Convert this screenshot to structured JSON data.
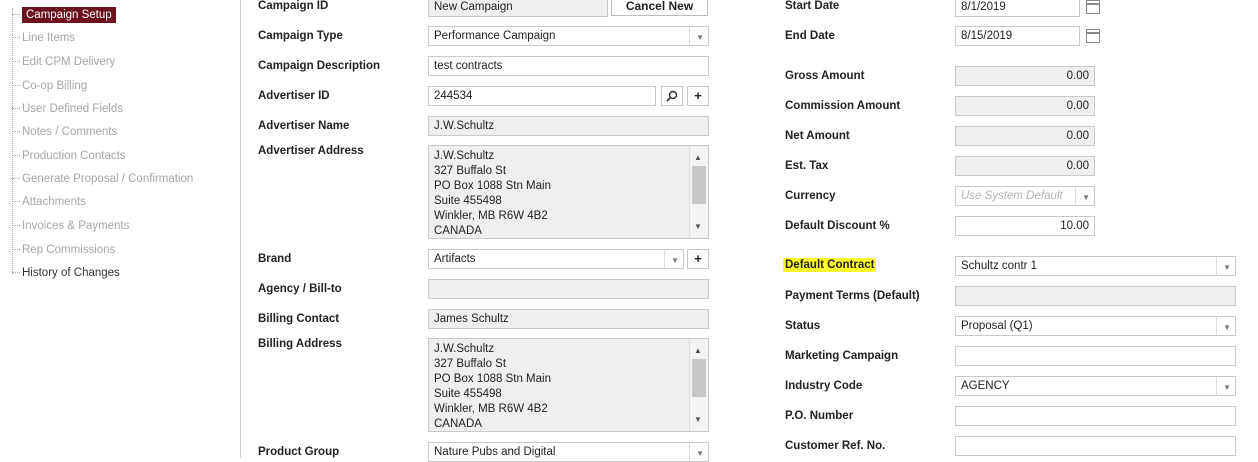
{
  "sidebar": {
    "items": [
      {
        "label": "Campaign Setup",
        "state": "active"
      },
      {
        "label": "Line Items",
        "state": "disabled"
      },
      {
        "label": "Edit CPM Delivery",
        "state": "disabled"
      },
      {
        "label": "Co-op Billing",
        "state": "disabled"
      },
      {
        "label": "User Defined Fields",
        "state": "disabled"
      },
      {
        "label": "Notes / Comments",
        "state": "disabled"
      },
      {
        "label": "Production Contacts",
        "state": "disabled"
      },
      {
        "label": "Generate Proposal / Confirmation",
        "state": "disabled"
      },
      {
        "label": "Attachments",
        "state": "disabled"
      },
      {
        "label": "Invoices & Payments",
        "state": "disabled"
      },
      {
        "label": "Rep Commissions",
        "state": "disabled"
      },
      {
        "label": "History of Changes",
        "state": "normal"
      }
    ]
  },
  "left": {
    "campaign_id": {
      "label": "Campaign ID",
      "value": "New Campaign"
    },
    "cancel_new": "Cancel New",
    "campaign_type": {
      "label": "Campaign Type",
      "value": "Performance Campaign"
    },
    "campaign_description": {
      "label": "Campaign Description",
      "value": "test contracts"
    },
    "advertiser_id": {
      "label": "Advertiser ID",
      "value": "244534"
    },
    "advertiser_name": {
      "label": "Advertiser Name",
      "value": "J.W.Schultz"
    },
    "advertiser_address": {
      "label": "Advertiser Address",
      "lines": [
        "J.W.Schultz",
        "327 Buffalo St",
        "PO Box 1088 Stn Main",
        "Suite 455498",
        "Winkler, MB R6W 4B2",
        "CANADA"
      ]
    },
    "brand": {
      "label": "Brand",
      "value": "Artifacts"
    },
    "agency": {
      "label": "Agency / Bill-to",
      "value": ""
    },
    "billing_contact": {
      "label": "Billing Contact",
      "value": "James Schultz"
    },
    "billing_address": {
      "label": "Billing Address",
      "lines": [
        "J.W.Schultz",
        "327 Buffalo St",
        "PO Box 1088 Stn Main",
        "Suite 455498",
        "Winkler, MB R6W 4B2",
        "CANADA"
      ]
    },
    "product_group": {
      "label": "Product Group",
      "value": "Nature Pubs and Digital"
    }
  },
  "right": {
    "start_date": {
      "label": "Start Date",
      "value": "8/1/2019"
    },
    "end_date": {
      "label": "End Date",
      "value": "8/15/2019"
    },
    "gross_amount": {
      "label": "Gross Amount",
      "value": "0.00"
    },
    "commission_amount": {
      "label": "Commission Amount",
      "value": "0.00"
    },
    "net_amount": {
      "label": "Net Amount",
      "value": "0.00"
    },
    "est_tax": {
      "label": "Est. Tax",
      "value": "0.00"
    },
    "currency": {
      "label": "Currency",
      "value": "Use System Default"
    },
    "default_discount": {
      "label": "Default Discount %",
      "value": "10.00"
    },
    "default_contract": {
      "label": "Default Contract",
      "value": "Schultz contr 1"
    },
    "payment_terms": {
      "label": "Payment Terms (Default)",
      "value": ""
    },
    "status": {
      "label": "Status",
      "value": "Proposal (Q1)"
    },
    "marketing_campaign": {
      "label": "Marketing Campaign",
      "value": ""
    },
    "industry_code": {
      "label": "Industry Code",
      "value": "AGENCY"
    },
    "po_number": {
      "label": "P.O. Number",
      "value": ""
    },
    "customer_ref": {
      "label": "Customer Ref. No.",
      "value": ""
    }
  },
  "colors": {
    "active_nav": "#6d0f1e",
    "highlight": "#ffff2a",
    "readonly_bg": "#efefef"
  },
  "icons": [
    "search-icon",
    "plus-icon",
    "calendar-icon",
    "chevron-down-icon",
    "scroll-up-icon",
    "scroll-down-icon"
  ]
}
